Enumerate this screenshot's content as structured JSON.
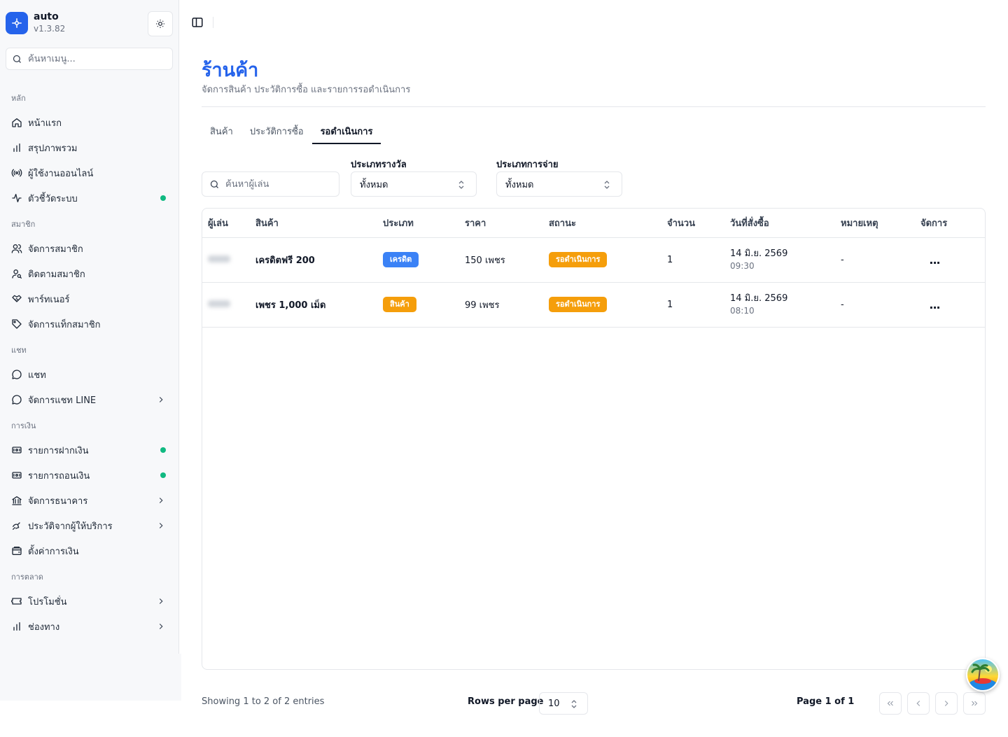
{
  "app": {
    "name": "auto",
    "version": "v1.3.82"
  },
  "menu_search": {
    "placeholder": "ค้นหาเมนู..."
  },
  "sidebar": {
    "sections": [
      {
        "label": "หลัก",
        "items": [
          {
            "label": "หน้าแรก",
            "icon": "home-icon"
          },
          {
            "label": "สรุปภาพรวม",
            "icon": "bar-chart-icon"
          },
          {
            "label": "ผู้ใช้งานออนไลน์",
            "icon": "broadcast-icon"
          },
          {
            "label": "ตัวชี้วัดระบบ",
            "icon": "activity-icon",
            "status_dot": true
          }
        ]
      },
      {
        "label": "สมาชิก",
        "items": [
          {
            "label": "จัดการสมาชิก",
            "icon": "users-icon"
          },
          {
            "label": "ติดตามสมาชิก",
            "icon": "user-search-icon"
          },
          {
            "label": "พาร์ทเนอร์",
            "icon": "handshake-icon"
          },
          {
            "label": "จัดการแท็กสมาชิก",
            "icon": "tag-icon"
          }
        ]
      },
      {
        "label": "แชท",
        "items": [
          {
            "label": "แชท",
            "icon": "message-circle-icon"
          },
          {
            "label": "จัดการแชท LINE",
            "icon": "message-circle-icon",
            "has_submenu": true
          }
        ]
      },
      {
        "label": "การเงิน",
        "items": [
          {
            "label": "รายการฝากเงิน",
            "icon": "deposit-icon",
            "status_dot": true
          },
          {
            "label": "รายการถอนเงิน",
            "icon": "withdraw-icon",
            "status_dot": true
          },
          {
            "label": "จัดการธนาคาร",
            "icon": "bank-icon",
            "has_submenu": true
          },
          {
            "label": "ประวัติจากผู้ให้บริการ",
            "icon": "provider-history-icon",
            "has_submenu": true
          },
          {
            "label": "ตั้งค่าการเงิน",
            "icon": "wallet-icon"
          }
        ]
      },
      {
        "label": "การตลาด",
        "items": [
          {
            "label": "โปรโมชั่น",
            "icon": "ticket-icon",
            "has_submenu": true
          },
          {
            "label": "ช่องทาง",
            "icon": "bar-chart-icon",
            "has_submenu": true
          }
        ]
      }
    ]
  },
  "page": {
    "title": "ร้านค้า",
    "subtitle": "จัดการสินค้า ประวัติการซื้อ และรายการรอดำเนินการ"
  },
  "tabs": [
    {
      "label": "สินค้า",
      "active": false
    },
    {
      "label": "ประวัติการซื้อ",
      "active": false
    },
    {
      "label": "รอดำเนินการ",
      "active": true
    }
  ],
  "filters": {
    "player_search_placeholder": "ค้นหาผู้เล่น",
    "reward_type": {
      "label": "ประเภทรางวัล",
      "value": "ทั้งหมด"
    },
    "payment_type": {
      "label": "ประเภทการจ่าย",
      "value": "ทั้งหมด"
    }
  },
  "table": {
    "columns": [
      "ผู้เล่น",
      "สินค้า",
      "ประเภท",
      "ราคา",
      "สถานะ",
      "จำนวน",
      "วันที่สั่งซื้อ",
      "หมายเหตุ",
      "จัดการ"
    ],
    "rows": [
      {
        "product": "เครดิตฟรี 200",
        "type": "เครดิต",
        "type_color": "#3b82f6",
        "price": "150 เพชร",
        "status": "รอดำเนินการ",
        "status_color": "#f59e0b",
        "quantity": "1",
        "date": "14 มิ.ย. 2569",
        "time": "09:30",
        "note": "-",
        "action": "..."
      },
      {
        "product": "เพชร 1,000 เม็ด",
        "type": "สินค้า",
        "type_color": "#f59e0b",
        "price": "99 เพชร",
        "status": "รอดำเนินการ",
        "status_color": "#f59e0b",
        "quantity": "1",
        "date": "14 มิ.ย. 2569",
        "time": "08:10",
        "note": "-",
        "action": "..."
      }
    ]
  },
  "pagination": {
    "showing": "Showing 1 to 2 of 2 entries",
    "rows_per_page_label": "Rows per page",
    "rows_per_page": "10",
    "page_info": "Page 1 of 1"
  },
  "colors": {
    "accent": "#2563eb",
    "status_dot": "#10b981",
    "pending": "#f59e0b",
    "credit": "#3b82f6"
  }
}
